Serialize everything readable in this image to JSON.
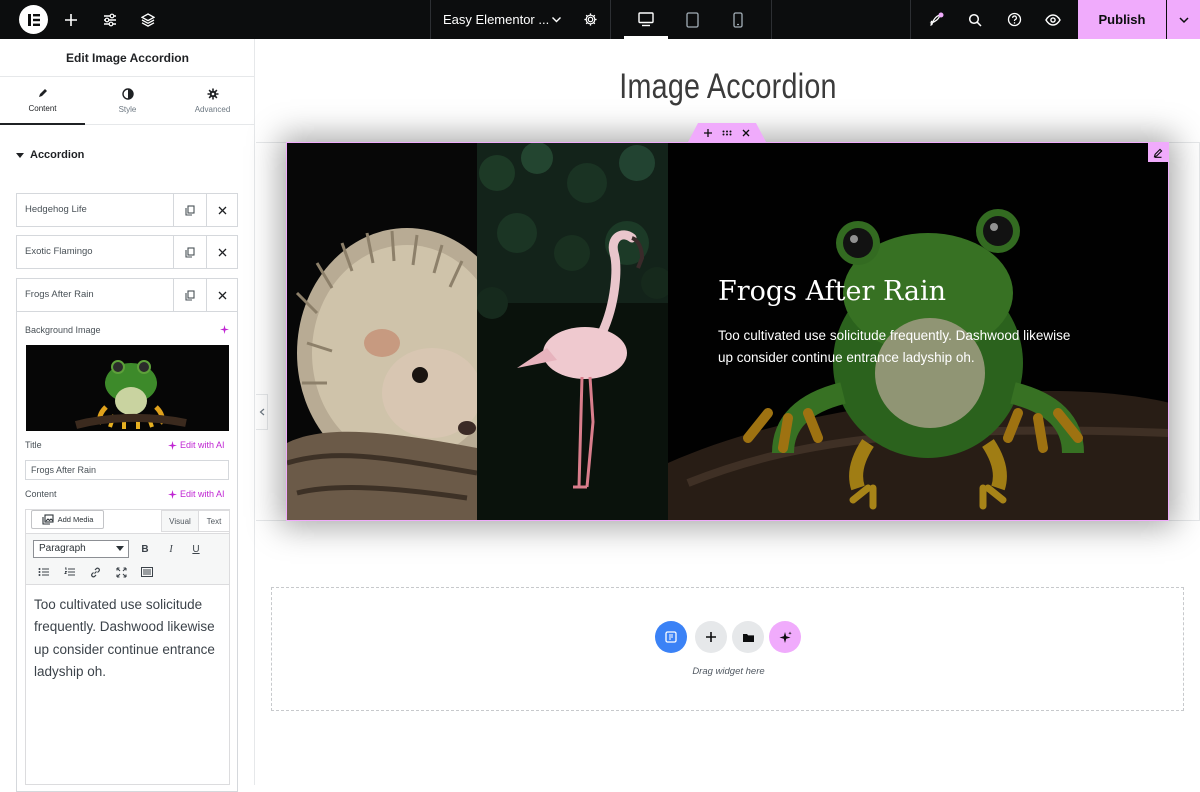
{
  "topbar": {
    "site_name": "Easy Elementor ...",
    "publish_label": "Publish"
  },
  "panel": {
    "title": "Edit Image Accordion",
    "tabs": [
      {
        "label": "Content"
      },
      {
        "label": "Style"
      },
      {
        "label": "Advanced"
      }
    ],
    "section_title": "Accordion",
    "items": [
      {
        "label": "Hedgehog Life"
      },
      {
        "label": "Exotic Flamingo"
      },
      {
        "label": "Frogs After Rain"
      }
    ],
    "background_image_label": "Background Image",
    "title_label": "Title",
    "edit_with_ai": "Edit with AI",
    "title_value": "Frogs After Rain",
    "content_label": "Content",
    "add_media_label": "Add Media",
    "visual_tab": "Visual",
    "text_tab": "Text",
    "format_value": "Paragraph",
    "editor_text": "Too cultivated use solicitude frequently. Dashwood likewise up consider continue entrance ladyship oh."
  },
  "canvas": {
    "page_title": "Image Accordion",
    "accordion": {
      "active_title": "Frogs After Rain",
      "active_content_line1": "Too cultivated use solicitude frequently. Dashwood likewise",
      "active_content_line2": "up consider continue entrance ladyship oh."
    },
    "drop_text": "Drag widget here"
  },
  "colors": {
    "accent": "#f0abfc",
    "ai": "#c026d3",
    "topbar": "#0c0d0e",
    "widget_blue": "#3b82f6"
  }
}
